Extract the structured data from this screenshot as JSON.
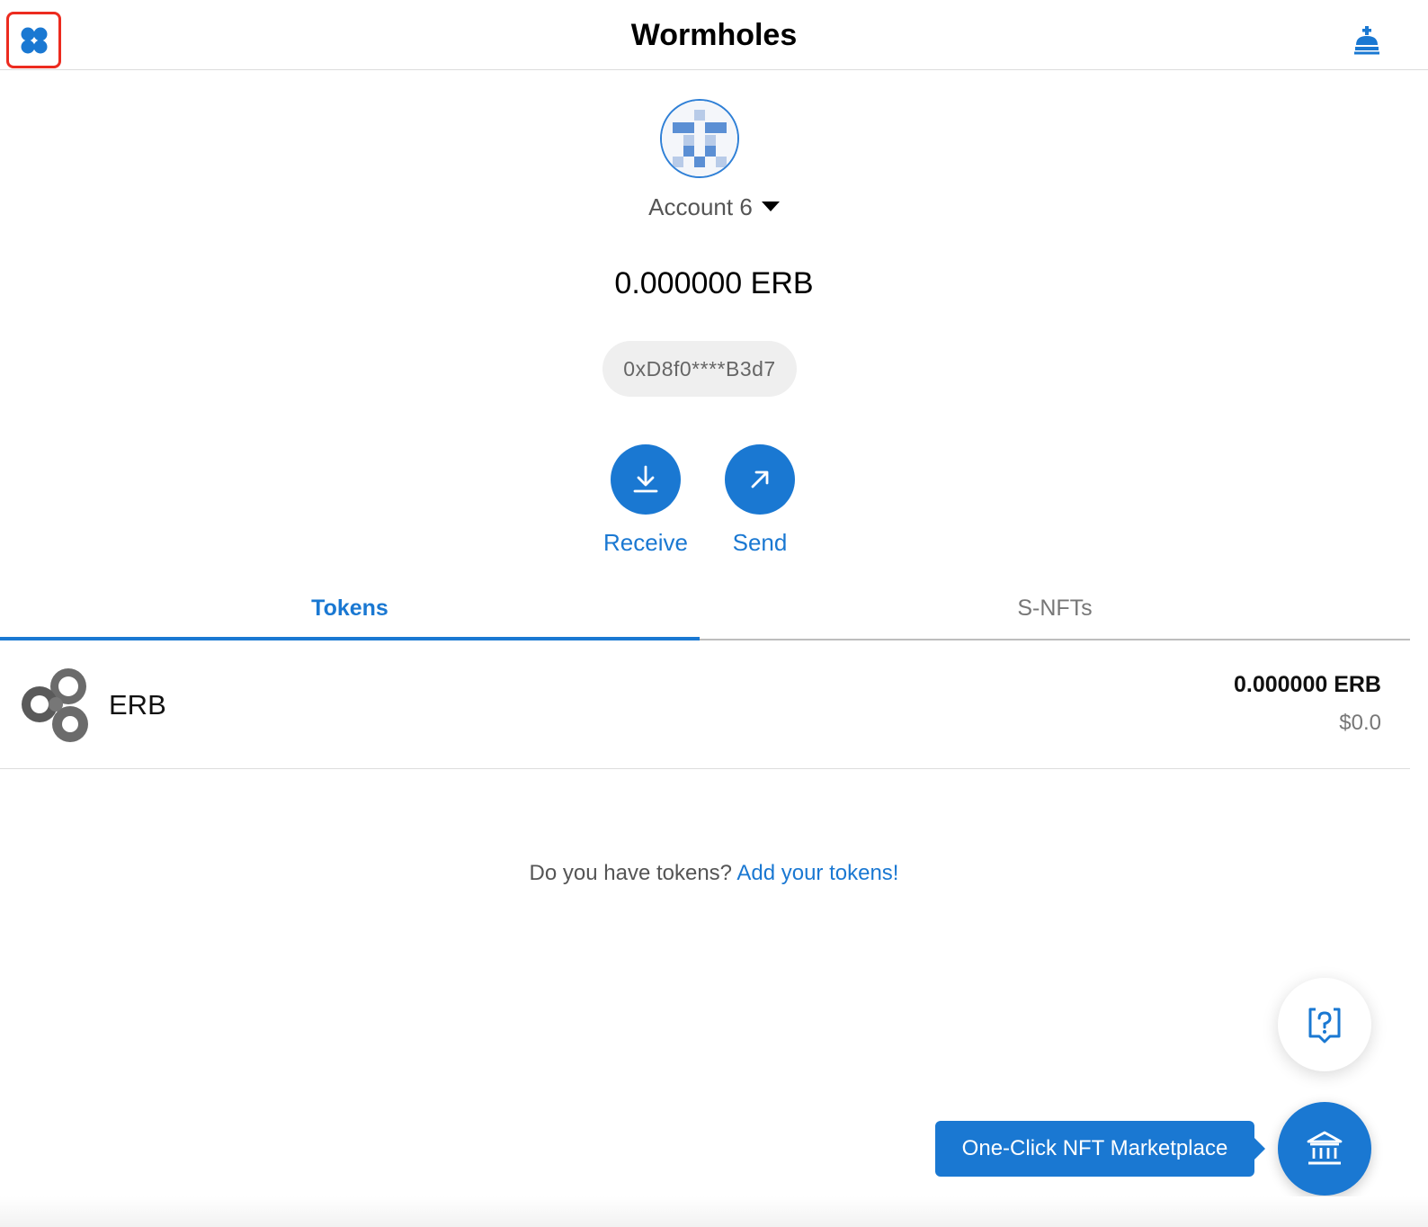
{
  "header": {
    "title": "Wormholes",
    "menu_icon": "four-petal-menu-icon",
    "account_icon": "king-icon"
  },
  "account": {
    "name": "Account 6",
    "avatar_icon": "pixel-identicon-avatar",
    "balance": "0.000000 ERB",
    "address": "0xD8f0****B3d7"
  },
  "actions": {
    "receive_label": "Receive",
    "send_label": "Send"
  },
  "tabs": {
    "tokens_label": "Tokens",
    "snfts_label": "S-NFTs",
    "active": "Tokens"
  },
  "tokens": [
    {
      "name": "ERB",
      "amount": "0.000000 ERB",
      "usd": "$0.0",
      "icon": "erb-logo-icon"
    }
  ],
  "add_tokens": {
    "prompt": "Do you have tokens?",
    "link": "Add your tokens!"
  },
  "floating": {
    "help_icon": "help-chat-icon",
    "marketplace_icon": "bank-building-icon",
    "marketplace_label": "One-Click NFT Marketplace"
  },
  "colors": {
    "accent": "#1a78d2",
    "highlight_box": "#ec2b1f",
    "muted_text": "#777777"
  }
}
